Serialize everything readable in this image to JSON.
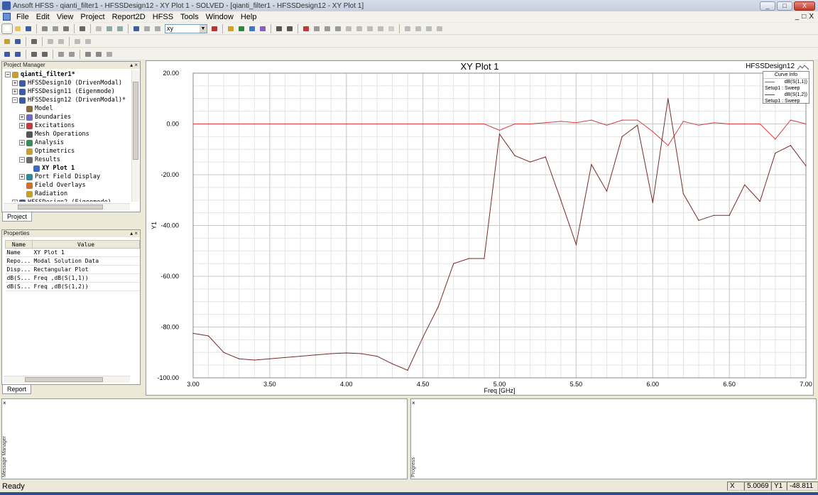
{
  "window": {
    "title": "Ansoft HFSS - qianti_filter1 - HFSSDesign12 - XY Plot 1 - SOLVED - [qianti_filter1 - HFSSDesign12 - XY Plot 1]",
    "min_label": "_",
    "max_label": "□",
    "close_label": "X"
  },
  "menu": {
    "items": [
      "File",
      "Edit",
      "View",
      "Project",
      "Report2D",
      "HFSS",
      "Tools",
      "Window",
      "Help"
    ],
    "doc_controls": [
      "_",
      "□",
      "X"
    ]
  },
  "toolbar": {
    "combo_value": "xy"
  },
  "project_manager": {
    "title": "Project Manager",
    "controls": "▴ ×",
    "tree": [
      {
        "label": "qianti_filter1*",
        "expander": "−",
        "indent": 0,
        "bold": true,
        "icon": "project-icon"
      },
      {
        "label": "HFSSDesign10 (DrivenModal)",
        "expander": "+",
        "indent": 1,
        "icon": "design-icon"
      },
      {
        "label": "HFSSDesign11 (Eigenmode)",
        "expander": "+",
        "indent": 1,
        "icon": "design-icon"
      },
      {
        "label": "HFSSDesign12 (DrivenModal)*",
        "expander": "−",
        "indent": 1,
        "icon": "design-icon"
      },
      {
        "label": "Model",
        "expander": "",
        "indent": 2,
        "icon": "model-icon"
      },
      {
        "label": "Boundaries",
        "expander": "+",
        "indent": 2,
        "icon": "boundaries-icon"
      },
      {
        "label": "Excitations",
        "expander": "+",
        "indent": 2,
        "icon": "excitations-icon"
      },
      {
        "label": "Mesh Operations",
        "expander": "",
        "indent": 2,
        "icon": "mesh-icon"
      },
      {
        "label": "Analysis",
        "expander": "+",
        "indent": 2,
        "icon": "analysis-icon"
      },
      {
        "label": "Optimetrics",
        "expander": "",
        "indent": 2,
        "icon": "optimetrics-icon"
      },
      {
        "label": "Results",
        "expander": "−",
        "indent": 2,
        "icon": "results-icon"
      },
      {
        "label": "XY Plot 1",
        "expander": "",
        "indent": 3,
        "bold": true,
        "icon": "xy-plot-icon"
      },
      {
        "label": "Port Field Display",
        "expander": "+",
        "indent": 2,
        "icon": "port-field-icon"
      },
      {
        "label": "Field Overlays",
        "expander": "",
        "indent": 2,
        "icon": "field-overlays-icon"
      },
      {
        "label": "Radiation",
        "expander": "",
        "indent": 2,
        "icon": "radiation-icon"
      },
      {
        "label": "HFSSDesign2 (Eigenmode)",
        "expander": "+",
        "indent": 1,
        "icon": "design-icon"
      }
    ],
    "tab": "Project"
  },
  "properties": {
    "title": "Properties",
    "controls": "▴ ×",
    "columns": [
      "Name",
      "Value"
    ],
    "rows": [
      {
        "name": "Name",
        "value": "XY Plot 1"
      },
      {
        "name": "Repo...",
        "value": "Modal Solution Data"
      },
      {
        "name": "Disp...",
        "value": "Rectangular Plot"
      },
      {
        "name": "dB(S...",
        "value": "Freq ,dB(S(1,1))"
      },
      {
        "name": "dB(S...",
        "value": "Freq ,dB(S(1,2))"
      }
    ],
    "tab": "Report"
  },
  "plot": {
    "design_label": "HFSSDesign12",
    "logo": "ANSOFT",
    "legend_title": "Curve Info",
    "legend": [
      {
        "name": "dB(S(1,1))",
        "sub": "Setup1 : Sweep",
        "color": "#e04040"
      },
      {
        "name": "dB(S(1,2))",
        "sub": "Setup1 : Sweep",
        "color": "#8b3030"
      }
    ]
  },
  "chart_data": {
    "type": "line",
    "title": "XY Plot 1",
    "xlabel": "Freq [GHz]",
    "ylabel": "Y1",
    "xlim": [
      3.0,
      7.0
    ],
    "ylim": [
      -100,
      20
    ],
    "xticks": [
      "3.00",
      "3.50",
      "4.00",
      "4.50",
      "5.00",
      "5.50",
      "6.00",
      "6.50",
      "7.00"
    ],
    "yticks": [
      "20.00",
      "0.00",
      "-20.00",
      "-40.00",
      "-60.00",
      "-80.00",
      "-100.00"
    ],
    "grid": true,
    "series": [
      {
        "name": "dB(S(1,1))",
        "color": "#e03a3a",
        "x": [
          3.0,
          4.9,
          5.0,
          5.1,
          5.2,
          5.3,
          5.4,
          5.5,
          5.6,
          5.7,
          5.8,
          5.9,
          6.0,
          6.1,
          6.2,
          6.3,
          6.4,
          6.5,
          6.6,
          6.7,
          6.8,
          6.9,
          7.0
        ],
        "y": [
          0.0,
          0.0,
          -2.5,
          0.0,
          0.0,
          0.5,
          1.0,
          0.5,
          1.5,
          -0.5,
          1.5,
          1.5,
          -3.0,
          -8.5,
          1.0,
          -0.5,
          0.5,
          0.0,
          0.0,
          0.0,
          -6.0,
          1.5,
          0.0
        ]
      },
      {
        "name": "dB(S(1,2))",
        "color": "#7a2a2a",
        "x": [
          3.0,
          3.1,
          3.2,
          3.3,
          3.4,
          3.5,
          3.6,
          3.7,
          3.8,
          3.9,
          4.0,
          4.1,
          4.2,
          4.3,
          4.4,
          4.5,
          4.6,
          4.7,
          4.8,
          4.9,
          5.0,
          5.1,
          5.2,
          5.3,
          5.4,
          5.5,
          5.6,
          5.7,
          5.8,
          5.9,
          6.0,
          6.1,
          6.2,
          6.3,
          6.4,
          6.5,
          6.6,
          6.7,
          6.8,
          6.9,
          7.0
        ],
        "y": [
          -82.5,
          -83.5,
          -90,
          -92.5,
          -93,
          -92.5,
          -92,
          -91.5,
          -91,
          -90.5,
          -90.2,
          -90.5,
          -91.5,
          -94.5,
          -97,
          -84,
          -72,
          -55,
          -53,
          -53,
          -4,
          -12.5,
          -15,
          -13,
          -30,
          -47.5,
          -16,
          -26.5,
          -5,
          -0.5,
          -31,
          10,
          -27.5,
          -38,
          -36,
          -36,
          -24,
          -30.5,
          -11.5,
          -8.5,
          -16.5
        ]
      }
    ]
  },
  "status": {
    "text": "Ready",
    "x_label": "X",
    "x_value": "5.0069",
    "y_label": "Y1",
    "y_value": "-48.811"
  },
  "bottom": {
    "left_label": "Message Manager",
    "right_label": "Progress"
  }
}
